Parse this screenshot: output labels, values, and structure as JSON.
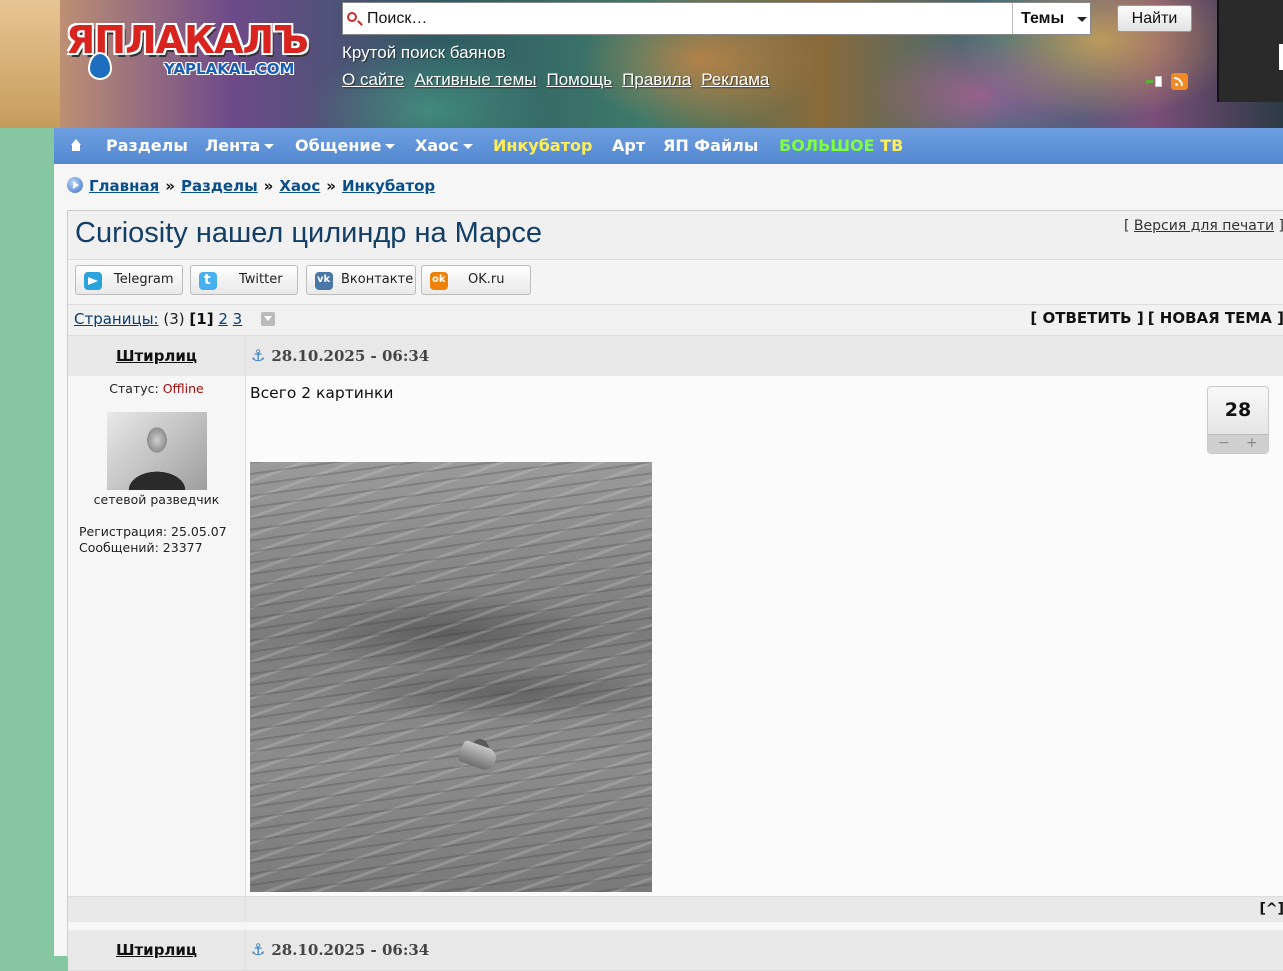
{
  "header": {
    "logo_text": "ЯПЛАКАЛЪ",
    "logo_sub": "YAPLAKAL.COM",
    "search": {
      "placeholder": "Поиск…",
      "scope_label": "Темы",
      "button_label": "Найти"
    },
    "tagline": "Крутой поиск баянов",
    "links": [
      "О сайте",
      "Активные темы",
      "Помощь",
      "Правила",
      "Реклама"
    ]
  },
  "nav": {
    "items": [
      {
        "label": "Разделы",
        "color": "#ffffff"
      },
      {
        "label": "Лента",
        "color": "#ffffff",
        "dropdown": true
      },
      {
        "label": "Общение",
        "color": "#ffffff",
        "dropdown": true
      },
      {
        "label": "Хаос",
        "color": "#ffffff",
        "dropdown": true
      },
      {
        "label": "Инкубатор",
        "color": "#ffee55"
      },
      {
        "label": "Арт",
        "color": "#ffffff"
      },
      {
        "label": "ЯП Файлы",
        "color": "#ffffff"
      },
      {
        "label": "БОЛЬШОЕ",
        "label2": "ТВ",
        "color": "#7fff3a",
        "color2": "#ffee55"
      }
    ]
  },
  "breadcrumb": {
    "items": [
      "Главная",
      "Разделы",
      "Хаос",
      "Инкубатор"
    ],
    "separator": "»"
  },
  "topic": {
    "title": "Curiosity нашел цилиндр на Марсе",
    "print_link": "Версия для печати"
  },
  "share": [
    {
      "label": "Telegram",
      "icon": "telegram-icon"
    },
    {
      "label": "Twitter",
      "icon": "twitter-icon"
    },
    {
      "label": "Вконтакте",
      "icon": "vk-icon"
    },
    {
      "label": "OK.ru",
      "icon": "ok-icon"
    }
  ],
  "pagination": {
    "label": "Страницы:",
    "count": "(3)",
    "current": "[1]",
    "pages": [
      "2",
      "3"
    ]
  },
  "actions": {
    "reply": "[ ОТВЕТИТЬ ]",
    "new_topic": "[ НОВАЯ ТЕМА ]"
  },
  "posts": [
    {
      "author": "Штирлиц",
      "date": "28.10.2025 - 06:34",
      "status_label": "Статус:",
      "status_value": "Offline",
      "user_title": "сетевой разведчик",
      "registration": "Регистрация: 25.05.07",
      "messages": "Сообщений: 23377",
      "text": "Всего 2 картинки",
      "rating": "28",
      "rating_minus": "−",
      "rating_plus": "+",
      "to_top": "[^]"
    },
    {
      "author": "Штирлиц",
      "date": "28.10.2025 - 06:34"
    }
  ]
}
